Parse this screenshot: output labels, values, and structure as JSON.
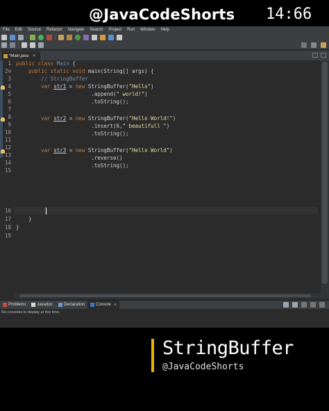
{
  "header": {
    "channel": "@JavaCodeShorts",
    "clock": "14:66"
  },
  "menubar": {
    "items": [
      "File",
      "Edit",
      "Source",
      "Refactor",
      "Navigate",
      "Search",
      "Project",
      "Run",
      "Window",
      "Help"
    ]
  },
  "toolbar": {
    "icons": [
      "new-icon",
      "save-icon",
      "print-icon",
      "debug-icon",
      "run-icon",
      "external-tools-icon",
      "new-java-project-icon",
      "new-package-icon",
      "new-class-icon",
      "open-type-icon",
      "search-icon",
      "back-icon",
      "forward-icon",
      "java-perspective-icon"
    ]
  },
  "editor": {
    "tab_label": "*Main.java",
    "line_numbers": [
      "1",
      "2",
      "3",
      "4",
      "5",
      "6",
      "7",
      "8",
      "9",
      "10",
      "11",
      "12",
      "13",
      "14",
      "15",
      "16",
      "17",
      "18",
      "19"
    ],
    "line_2_marker": "⊖",
    "code": {
      "l1_kw": "public class ",
      "l1_name": "Main",
      "l1_rest": " {",
      "l2_indent": "    ",
      "l2_kw": "public static void ",
      "l2_rest": "main(String[] args) {",
      "l3": "        // StringBuffer",
      "l4_a": "        ",
      "l4_kw": "var ",
      "l4_var": "str1",
      "l4_b": " = ",
      "l4_new": "new ",
      "l4_c": "StringBuffer(",
      "l4_str": "\"Hello\"",
      "l4_d": ")",
      "l5_a": "                        .append(",
      "l5_str": "\" world!\"",
      "l5_b": ")",
      "l6": "                        .toString();",
      "l8_a": "        ",
      "l8_kw": "var ",
      "l8_var": "str2",
      "l8_b": " = ",
      "l8_new": "new ",
      "l8_c": "StringBuffer(",
      "l8_str": "\"Hello World!\"",
      "l8_d": ")",
      "l9_a": "                        .insert(6,",
      "l9_str": "\" beautifull \"",
      "l9_b": ")",
      "l10": "                        .toString();",
      "l12_a": "        ",
      "l12_kw": "var ",
      "l12_var": "str3",
      "l12_b": " = ",
      "l12_new": "new ",
      "l12_c": "StringBuffer(",
      "l12_str": "\"Hello World\"",
      "l12_d": ")",
      "l13": "                        .reverse()",
      "l14": "                        .toString();",
      "l17": "    }",
      "l18": "}"
    }
  },
  "bottom_panel": {
    "tabs": [
      {
        "label": "Problems"
      },
      {
        "label": "Javadoc"
      },
      {
        "label": "Declaration"
      },
      {
        "label": "Console"
      }
    ],
    "console_message": "No consoles to display at this time."
  },
  "overlay": {
    "title": "StringBuffer",
    "subtitle": "@JavaCodeShorts",
    "accent_color": "#e8b100"
  },
  "colors": {
    "keyword": "#cc7832",
    "string": "#dfe1a0",
    "comment": "#7c8c9c",
    "class_name": "#6897bb",
    "editor_bg": "#2b2b2b"
  }
}
